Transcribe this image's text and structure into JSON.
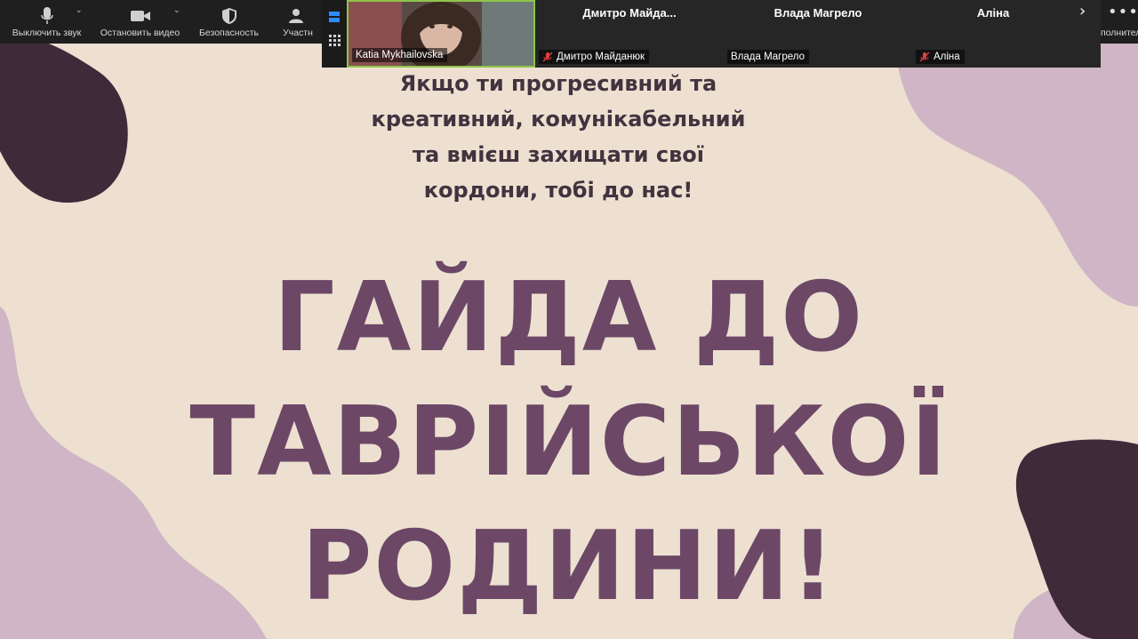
{
  "toolbar": {
    "mute_label": "Выключить звук",
    "video_label": "Остановить видео",
    "security_label": "Безопасность",
    "participants_label": "Участн",
    "more_label": "полнител"
  },
  "gallery": {
    "tiles": [
      {
        "video_label": "Katia Mykhailovska",
        "muted": false
      },
      {
        "header": "Дмитро  Майда...",
        "video_label": "Дмитро Майданюк",
        "muted": true
      },
      {
        "header": "Влада Магрело",
        "video_label": "Влада Магрело",
        "muted": false
      },
      {
        "header": "Аліна",
        "video_label": "Аліна",
        "muted": true
      }
    ]
  },
  "slide": {
    "subtitle_lines": [
      "Якщо ти прогресивний та",
      "креативний, комунікабельний",
      "та вмієш захищати свої",
      "кордони, тобі до нас!"
    ],
    "title_lines": [
      "ГАЙДА ДО",
      "ТАВРІЙСЬКОЇ",
      "РОДИНИ!"
    ]
  },
  "colors": {
    "background": "#ede0d1",
    "lilac": "#cfb5c5",
    "dark_plum": "#3f2a3a",
    "title": "#6c4766",
    "subtitle": "#43323f",
    "zoom_bar": "#1f1f1f",
    "active_speaker": "#8ec547",
    "muted_red": "#e04040"
  }
}
